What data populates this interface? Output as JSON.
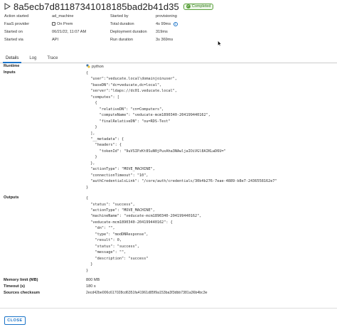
{
  "header": {
    "title": "8a5ecb7d81187341018185bad2b41d35",
    "status": "Completed"
  },
  "info_left": [
    {
      "label": "Action started",
      "value": "ad_machine"
    },
    {
      "label": "FaaS provider",
      "value": "On Prem"
    },
    {
      "label": "Started on",
      "value": "06/21/22, 11:07 AM"
    },
    {
      "label": "Started via",
      "value": "API"
    }
  ],
  "info_right": [
    {
      "label": "Started by",
      "value": "provisioning"
    },
    {
      "label": "Total duration",
      "value": "4s 99ms"
    },
    {
      "label": "Deployment duration",
      "value": "319ms"
    },
    {
      "label": "Run duration",
      "value": "3s 369ms"
    }
  ],
  "tabs": [
    "Details",
    "Log",
    "Trace"
  ],
  "details": {
    "runtime_label": "Runtime",
    "runtime_value": "python",
    "inputs_label": "Inputs",
    "inputs_code": "{\n  \"user\":\"veducate.local\\domainjoinuser\",\n  \"baseDN\":\"dc=veducate,dc=local\",\n  \"server\":\"ldaps://dc01.veducate.local\",\n  \"computes\": [\n    {\n      \"relativeDN\": \"cn=Computers\",\n      \"computeName\": \"veducate-mcm1890340-204199440162\",\n      \"finalRelativeDN\": \"ou=RDS-Test\"\n    }\n  ],\n  \"__metadata\": {\n    \"headers\": {\n      \"tokenId\": \"9uVSIPzKt8SuN0jPuxAha3NAwljaIOiVGl8AIKLwD6U=\"\n    }\n  },\n  \"actionType\": \"MOVE_MACHINE\",\n  \"connectionTimeout\": \"10\",\n  \"authCredentialsLink\": \"/core/auth/credentials/30b4b276-7eae-4889-b8e7-2436558162e7\"\n}",
    "outputs_label": "Outputs",
    "outputs_code": "{\n  \"status\": \"success\",\n  \"actionType\": \"MOVE_MACHINE\",\n  \"machineName\": \"veducate-mcm1890340-204199440162\",\n  \"veducate-mcm1890340-204199440162\": {\n    \"dn\": \"\",\n    \"type\": \"modDNResponse\",\n    \"result\": 0,\n    \"status\": \"success\",\n    \"message\": \"\",\n    \"description\": \"success\"\n  }\n}",
    "memory_label": "Memory limit (MB)",
    "memory_value": "800 MB",
    "timeout_label": "Timeout (s)",
    "timeout_value": "180 s",
    "checksum_label": "Sources checksum",
    "checksum_value": "2ecd42be006c617028cd6351fa41961d85f9a153ba3f3dbb7381a36b4bc3e"
  },
  "footer": {
    "close_label": "CLOSE"
  },
  "colors": {
    "accent": "#1a73c8",
    "success": "#5aa03c"
  }
}
